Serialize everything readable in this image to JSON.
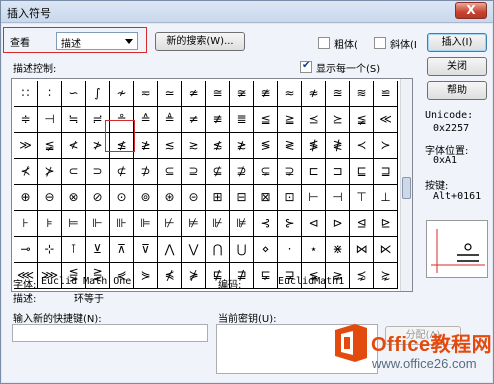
{
  "window": {
    "title": "插入符号",
    "close_label": "X"
  },
  "toolbar": {
    "view_label": "查看",
    "view_select": "描述",
    "new_search_button": "新的搜索(W)...",
    "bold_label": "粗体(",
    "italic_label": "斜体(I",
    "insert_button": "插入(I)"
  },
  "side_buttons": {
    "close": "关闭",
    "help": "帮助"
  },
  "symbols": {
    "heading": "描述控制:",
    "show_each_label": "显示每一个(S)",
    "show_each_checked": true,
    "grid": [
      [
        "∷",
        "∶",
        "∽",
        "∫",
        "≁",
        "≂",
        "≃",
        "≄",
        "≅",
        "≆",
        "≇",
        "≈",
        "≉",
        "≊",
        "≋",
        "≌"
      ],
      [
        "≑",
        "⊣",
        "≒",
        "≓",
        "≗",
        "≙",
        "≜",
        "≠",
        "≢",
        "≣",
        "≦",
        "≧",
        "⪯",
        "⪰",
        "≨",
        "≪"
      ],
      [
        "≫",
        "≨",
        "≮",
        "≯",
        "≰",
        "≱",
        "≲",
        "≳",
        "≴",
        "≵",
        "≶",
        "≷",
        "≸",
        "≹",
        "≺",
        "≻"
      ],
      [
        "⊀",
        "⊁",
        "⊂",
        "⊃",
        "⊄",
        "⊅",
        "⊆",
        "⊇",
        "⊈",
        "⊉",
        "⊊",
        "⊋",
        "⊏",
        "⊐",
        "⊑",
        "⊒"
      ],
      [
        "⊕",
        "⊖",
        "⊗",
        "⊘",
        "⊙",
        "⊚",
        "⊛",
        "⊝",
        "⊞",
        "⊟",
        "⊠",
        "⊡",
        "⊢",
        "⊣",
        "⊤",
        "⊥"
      ],
      [
        "⊦",
        "⊧",
        "⊨",
        "⊩",
        "⊪",
        "⊫",
        "⊬",
        "⊭",
        "⊮",
        "⊯",
        "⊰",
        "⊱",
        "⊲",
        "⊳",
        "⊴",
        "⊵"
      ],
      [
        "⊸",
        "⊹",
        "⊺",
        "⊻",
        "⊼",
        "⊽",
        "⋀",
        "⋁",
        "⋂",
        "⋃",
        "⋄",
        "⋅",
        "⋆",
        "⋇",
        "⋈",
        "⋉"
      ],
      [
        "⋘",
        "⋙",
        "⋚",
        "⋛",
        "⋞",
        "⋟",
        "⋠",
        "⋡",
        "⋢",
        "⋣",
        "⋤",
        "⋥",
        "⋦",
        "⋧",
        "⋨",
        "⋩"
      ]
    ]
  },
  "info": {
    "unicode_label": "Unicode:",
    "unicode_value": "0x2257",
    "font_pos_label": "字体位置:",
    "font_pos_value": "0xA1",
    "key_label": "按键:",
    "key_value": "Alt+0161",
    "font_label": "字体:",
    "font_value": "Euclid Math One",
    "code_label": "编码:",
    "code_value": "EuclidMath1",
    "desc_label": "描述:",
    "desc_value": "环等于"
  },
  "shortcut": {
    "new_key_label": "输入新的快捷键(N):",
    "current_key_label": "当前密钥(U):",
    "assign_button": "分配(A)"
  },
  "watermark": {
    "brand": "Office教程网",
    "url": "www.office26.com"
  }
}
